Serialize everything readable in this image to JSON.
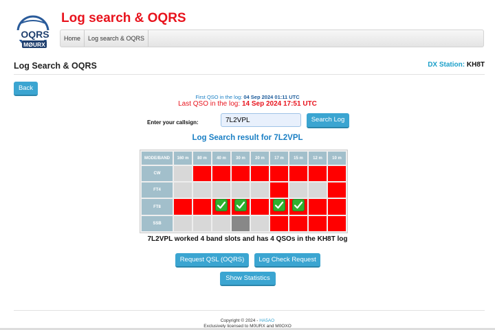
{
  "site": {
    "title": "Log search & OQRS",
    "logo_text_top": "OQRS",
    "logo_text_bottom": "MØURX"
  },
  "nav": {
    "items": [
      "Home",
      "Log search & OQRS"
    ]
  },
  "page": {
    "title": "Log Search & OQRS",
    "dx_label": "DX Station:",
    "dx_value": "KH8T"
  },
  "back_label": "Back",
  "first_qso": {
    "label": "First QSO in the log:",
    "value": "04 Sep 2024 01:11 UTC"
  },
  "last_qso": {
    "label": "Last QSO in the log:",
    "value": "14 Sep 2024 17:51 UTC"
  },
  "search": {
    "label": "Enter your callsign:",
    "value": "7L2VPL",
    "button": "Search Log"
  },
  "result_title": "Log Search result for 7L2VPL",
  "table": {
    "header": "MODE/BAND",
    "bands": [
      "160 m",
      "80 m",
      "40 m",
      "30 m",
      "20 m",
      "17 m",
      "15 m",
      "12 m",
      "10 m"
    ],
    "rows": [
      {
        "mode": "CW",
        "cells": [
          "grey",
          "red",
          "red",
          "red",
          "red",
          "red",
          "red",
          "red",
          "red"
        ]
      },
      {
        "mode": "FT4",
        "cells": [
          "grey",
          "grey",
          "grey",
          "grey",
          "grey",
          "red",
          "grey",
          "grey",
          "red"
        ]
      },
      {
        "mode": "FT8",
        "cells": [
          "red",
          "red",
          "check",
          "check",
          "red",
          "check",
          "check",
          "red",
          "red"
        ]
      },
      {
        "mode": "SSB",
        "cells": [
          "grey",
          "grey",
          "grey",
          "dark",
          "grey",
          "red",
          "red",
          "red",
          "red"
        ]
      }
    ]
  },
  "colors": {
    "red": "#ff0000",
    "grey": "#d8d8d8",
    "dark": "#888888",
    "check": "#2fb02f",
    "accent": "#3ba5d1"
  },
  "summary": "7L2VPL worked 4 band slots and has 4 QSOs in the KH8T log",
  "buttons": {
    "request_qsl": "Request QSL (OQRS)",
    "log_check": "Log Check Request",
    "show_stats": "Show Statistics"
  },
  "footer": {
    "copyright": "Copyright © 2024 -",
    "author": "HA5AO",
    "license": "Exclusively licensed to M0URX and M0OXO"
  }
}
